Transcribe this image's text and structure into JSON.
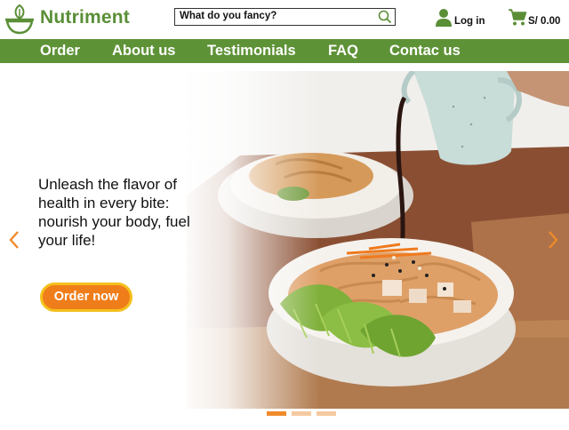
{
  "brand": {
    "name": "Nutriment",
    "color": "#5a8f37"
  },
  "search": {
    "placeholder": "What do you fancy?"
  },
  "header": {
    "login_label": "Log in",
    "cart_total": "S/ 0.00"
  },
  "nav": {
    "items": [
      {
        "label": "Order"
      },
      {
        "label": "About us"
      },
      {
        "label": "Testimonials"
      },
      {
        "label": "FAQ"
      },
      {
        "label": "Contac us"
      }
    ],
    "color": "#5e9237"
  },
  "hero": {
    "headline": "Unleash the flavor of health in every bite: nourish your body, fuel your life!",
    "cta_label": "Order now",
    "cta_color": "#ef7d1a",
    "slide_count": 3,
    "active_slide": 1
  },
  "icons": {
    "logo": "bowl-leaf-icon",
    "search": "search-icon",
    "user": "user-icon",
    "cart": "cart-icon",
    "prev": "chevron-left-icon",
    "next": "chevron-right-icon"
  }
}
